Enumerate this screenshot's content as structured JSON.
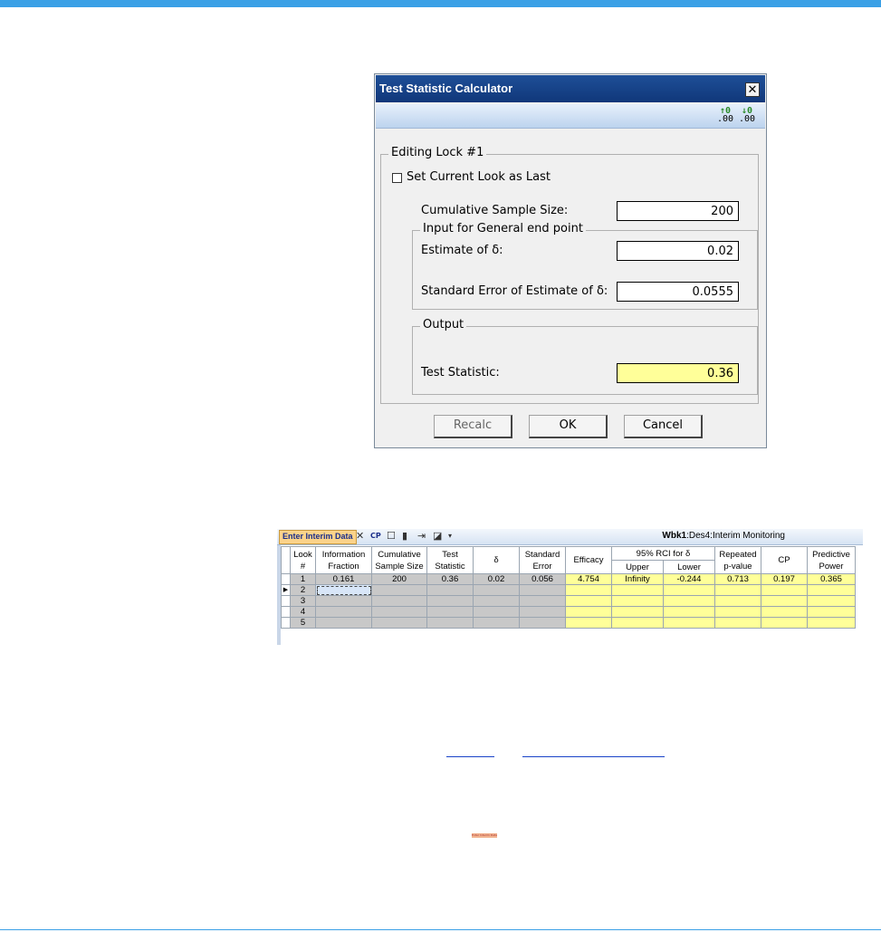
{
  "dialog": {
    "title": "Test Statistic Calculator",
    "close_glyph": "✕",
    "toolbar": {
      "increase_decimals": ".00",
      "decrease_decimals": ".00",
      "increase_arrow": "↑0",
      "decrease_arrow": "↓0"
    },
    "group_editing": "Editing Lock #1",
    "set_last_label": "Set Current Look as Last",
    "cum_sample_label": "Cumulative Sample Size:",
    "cum_sample_value": "200",
    "group_input": "Input for General end point",
    "estimate_label": "Estimate of δ:",
    "estimate_value": "0.02",
    "se_label": "Standard Error of Estimate of δ:",
    "se_value": "0.0555",
    "group_output": "Output",
    "teststat_label": "Test Statistic:",
    "teststat_value": "0.36",
    "recalc_label": "Recalc",
    "ok_label": "OK",
    "cancel_label": "Cancel"
  },
  "grid": {
    "tab_label": "Enter Interim Data",
    "title_bold": "Wbk1",
    "title_rest": ":Des4:Interim Monitoring",
    "headers": {
      "look1": "Look",
      "look2": "#",
      "info1": "Information",
      "info2": "Fraction",
      "cum1": "Cumulative",
      "cum2": "Sample Size",
      "ts1": "Test",
      "ts2": "Statistic",
      "delta": "δ",
      "se1": "Standard",
      "se2": "Error",
      "efficacy": "Efficacy",
      "rci": "95% RCI for δ",
      "upper": "Upper",
      "lower": "Lower",
      "rp1": "Repeated",
      "rp2": "p-value",
      "cp": "CP",
      "pp1": "Predictive",
      "pp2": "Power"
    },
    "row1": {
      "look": "1",
      "info": "0.161",
      "cum": "200",
      "ts": "0.36",
      "delta": "0.02",
      "se": "0.056",
      "efficacy": "4.754",
      "upper": "Infinity",
      "lower": "-0.244",
      "rp": "0.713",
      "cp": "0.197",
      "pp": "0.365"
    },
    "looks": [
      "2",
      "3",
      "4",
      "5"
    ],
    "row_marker": "▶"
  },
  "badge_text": "Enter Interim Data"
}
